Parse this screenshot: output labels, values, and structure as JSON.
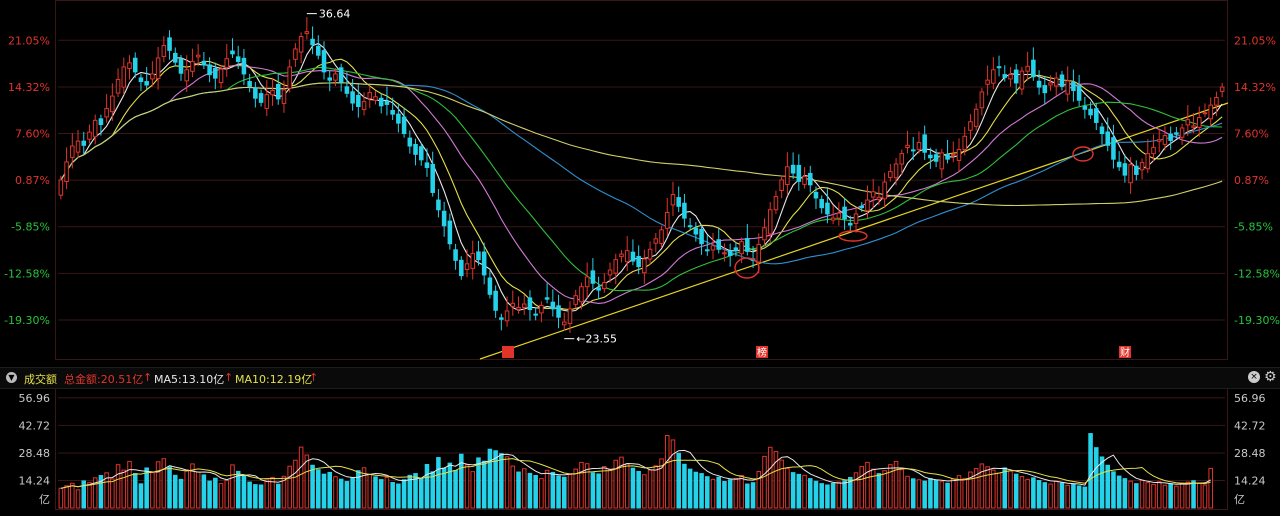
{
  "colors": {
    "up": "#e0342b",
    "down": "#25d2ea",
    "ma_white": "#e8e8e8",
    "ma_yellow": "#e4e04a",
    "ma_pink": "#d07bd6",
    "ma_green": "#2fbf3a",
    "ma_blue": "#2e8fcf",
    "ma_long": "#cfcf6a",
    "trendline": "#e4d324",
    "grid": "#3a1616",
    "axis_text_red": "#e0342b",
    "axis_text_green": "#27c43c",
    "vol_text": "#c8c8c8"
  },
  "price_panel": {
    "y_ticks": [
      "21.05%",
      "14.32%",
      "7.60%",
      "0.87%",
      "-5.85%",
      "-12.58%",
      "-19.30%"
    ],
    "y_tick_values": [
      21.05,
      14.32,
      7.6,
      0.87,
      -5.85,
      -12.58,
      -19.3
    ],
    "max_label": "36.64",
    "min_label": "23.55",
    "event_markers": [
      "",
      "榜",
      "财"
    ]
  },
  "volume_panel": {
    "title": "成交额",
    "total_label": "总金额:20.51亿",
    "ma5_label": "MA5:13.10亿",
    "ma10_label": "MA10:12.19亿",
    "y_ticks": [
      "56.96",
      "42.72",
      "28.48",
      "14.24"
    ],
    "y_tick_values": [
      56.96,
      42.72,
      28.48,
      14.24
    ],
    "unit": "亿"
  },
  "chart_data": {
    "type": "candlestick",
    "title": "",
    "price_range_pct": [
      -24.5,
      26.0
    ],
    "volume_range": [
      0,
      60
    ],
    "close_pct": [
      0.9,
      3.5,
      5.8,
      6.5,
      5.9,
      7.8,
      9.5,
      8.9,
      11.2,
      13.0,
      15.4,
      17.2,
      17.8,
      16.5,
      15.1,
      14.6,
      16.2,
      18.5,
      20.3,
      19.6,
      17.9,
      16.3,
      16.8,
      18.0,
      18.9,
      17.5,
      16.1,
      15.6,
      16.9,
      18.4,
      19.1,
      18.0,
      16.2,
      14.4,
      12.7,
      12.1,
      13.2,
      13.8,
      12.6,
      13.9,
      17.2,
      19.8,
      21.6,
      22.3,
      20.4,
      18.9,
      16.5,
      15.3,
      16.2,
      15.0,
      13.4,
      12.0,
      11.5,
      12.2,
      13.5,
      12.9,
      11.6,
      11.8,
      10.4,
      9.1,
      7.6,
      5.8,
      4.6,
      3.8,
      2.7,
      -0.9,
      -3.4,
      -5.7,
      -8.3,
      -10.7,
      -12.9,
      -11.2,
      -9.7,
      -10.6,
      -12.8,
      -15.6,
      -17.9,
      -19.2,
      -18.0,
      -16.9,
      -17.5,
      -17.0,
      -17.8,
      -18.5,
      -17.2,
      -16.3,
      -17.7,
      -18.9,
      -19.6,
      -17.7,
      -15.8,
      -14.5,
      -13.1,
      -14.0,
      -15.0,
      -13.9,
      -12.1,
      -10.6,
      -9.8,
      -9.3,
      -10.8,
      -11.6,
      -10.5,
      -9.1,
      -7.6,
      -6.3,
      -3.8,
      -1.2,
      -2.9,
      -4.6,
      -5.8,
      -6.9,
      -8.3,
      -9.2,
      -8.6,
      -9.1,
      -9.6,
      -10.0,
      -9.3,
      -8.0,
      -9.4,
      -10.7,
      -8.4,
      -6.0,
      -3.4,
      -1.5,
      0.9,
      2.8,
      1.9,
      0.7,
      1.4,
      0.2,
      -1.7,
      -3.1,
      -4.0,
      -4.6,
      -3.9,
      -4.7,
      -5.6,
      -4.0,
      -3.1,
      -2.0,
      -0.8,
      -1.6,
      0.6,
      2.1,
      3.2,
      4.7,
      5.9,
      5.1,
      6.3,
      4.9,
      4.1,
      3.6,
      4.8,
      3.9,
      4.6,
      5.3,
      7.2,
      9.3,
      11.1,
      13.6,
      15.3,
      16.8,
      17.2,
      15.7,
      16.1,
      14.9,
      16.6,
      17.3,
      15.8,
      14.3,
      13.5,
      14.9,
      15.6,
      14.4,
      15.2,
      13.8,
      12.4,
      11.1,
      10.3,
      9.2,
      7.6,
      5.9,
      3.9,
      2.8,
      1.6,
      3.1,
      1.7,
      3.4,
      4.7,
      5.6,
      6.7,
      7.3,
      6.6,
      7.5,
      8.4,
      9.6,
      8.7,
      9.9,
      10.6,
      11.7,
      12.8,
      14.3
    ],
    "volume": [
      10.2,
      11.5,
      12.8,
      9.4,
      14.0,
      13.1,
      15.6,
      16.8,
      18.2,
      15.0,
      22.4,
      19.6,
      24.1,
      17.8,
      12.5,
      20.7,
      18.3,
      23.9,
      25.5,
      21.2,
      16.9,
      14.8,
      19.7,
      22.8,
      18.6,
      17.1,
      13.9,
      15.4,
      12.6,
      14.2,
      22.3,
      18.9,
      16.7,
      13.4,
      12.1,
      11.9,
      14.5,
      15.8,
      12.3,
      16.4,
      21.6,
      24.7,
      31.5,
      27.4,
      22.1,
      19.8,
      17.5,
      18.4,
      16.2,
      14.9,
      13.7,
      15.6,
      19.3,
      20.8,
      17.4,
      16.1,
      14.7,
      15.8,
      13.2,
      12.4,
      14.6,
      16.9,
      17.8,
      15.4,
      22.5,
      18.7,
      26.1,
      20.6,
      23.2,
      19.4,
      27.8,
      22.3,
      18.8,
      25.9,
      24.2,
      30.4,
      29.6,
      28.1,
      26.5,
      21.7,
      18.6,
      20.3,
      17.9,
      16.8,
      15.2,
      19.5,
      18.4,
      16.6,
      15.9,
      17.3,
      20.1,
      23.6,
      22.9,
      18.2,
      17.6,
      21.4,
      19.8,
      24.7,
      26.3,
      22.8,
      20.6,
      18.9,
      17.2,
      19.6,
      21.8,
      25.4,
      37.5,
      35.2,
      28.3,
      22.6,
      20.1,
      18.5,
      17.8,
      16.2,
      14.8,
      15.9,
      13.7,
      14.6,
      15.3,
      16.8,
      12.4,
      13.1,
      18.9,
      26.7,
      31.4,
      29.2,
      24.8,
      20.5,
      18.3,
      17.4,
      16.9,
      15.2,
      13.8,
      12.6,
      11.9,
      12.7,
      13.4,
      14.1,
      15.8,
      18.2,
      21.5,
      23.6,
      20.1,
      17.8,
      19.3,
      22.4,
      24.1,
      19.8,
      16.4,
      15.1,
      14.6,
      13.9,
      15.2,
      14.3,
      13.6,
      12.8,
      14.9,
      16.7,
      15.3,
      18.6,
      20.4,
      22.8,
      21.3,
      19.6,
      18.1,
      20.7,
      19.2,
      17.5,
      16.3,
      14.8,
      15.6,
      14.2,
      13.1,
      12.4,
      13.8,
      12.9,
      11.7,
      12.3,
      11.4,
      10.8,
      38.5,
      31.2,
      26.4,
      22.1,
      18.7,
      16.5,
      15.2,
      13.9,
      12.6,
      14.3,
      13.1,
      12.2,
      13.6,
      11.8,
      12.5,
      11.3,
      12.9,
      13.4,
      14.1,
      12.7,
      11.9,
      20.5
    ],
    "ma5_volume": 13.1,
    "ma10_volume": 12.19,
    "extremes": {
      "max_price_label": "36.64",
      "min_price_label": "23.55"
    }
  }
}
